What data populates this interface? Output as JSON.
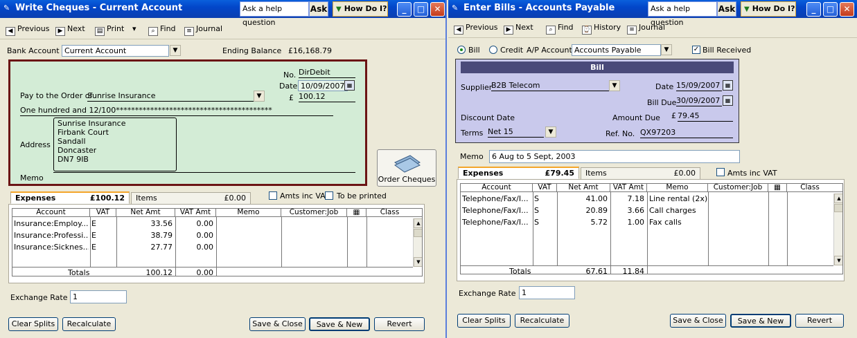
{
  "left": {
    "title": "Write Cheques - Current Account",
    "help_placeholder": "Ask a help question",
    "ask_label": "Ask",
    "howdoi_label": "How Do I?",
    "toolbar": {
      "previous": "Previous",
      "next": "Next",
      "print": "Print",
      "find": "Find",
      "journal": "Journal"
    },
    "bank_account_label": "Bank Account",
    "bank_account_value": "Current Account",
    "ending_balance_label": "Ending Balance",
    "ending_balance_value": "£16,168.79",
    "cheque": {
      "no_label": "No.",
      "no_value": "DirDebit",
      "date_label": "Date",
      "date_value": "10/09/2007",
      "pay_to_label": "Pay to the Order of",
      "pay_to_value": "Sunrise Insurance",
      "currency_symbol": "£",
      "amount_value": "100.12",
      "amount_words": "One hundred and 12/100*****************************************",
      "address_label": "Address",
      "address_lines": [
        "Sunrise Insurance",
        "Firbank Court",
        "Sandall",
        "Doncaster",
        "DN7 9IB"
      ],
      "memo_label": "Memo",
      "memo_value": ""
    },
    "order_cheques_label": "Order Cheques",
    "tabs": {
      "expenses_label": "Expenses",
      "expenses_amount": "£100.12",
      "items_label": "Items",
      "items_amount": "£0.00"
    },
    "amts_inc_vat_label": "Amts inc VAT",
    "to_be_printed_label": "To be printed",
    "columns": [
      "Account",
      "VAT",
      "Net Amt",
      "VAT Amt",
      "Memo",
      "Customer:Job",
      "",
      "Class"
    ],
    "rows": [
      {
        "account": "Insurance:Employ...",
        "vat": "E",
        "net": "33.56",
        "vatamt": "0.00"
      },
      {
        "account": "Insurance:Professi...",
        "vat": "E",
        "net": "38.79",
        "vatamt": "0.00"
      },
      {
        "account": "Insurance:Sicknes...",
        "vat": "E",
        "net": "27.77",
        "vatamt": "0.00"
      }
    ],
    "totals_label": "Totals",
    "totals_net": "100.12",
    "totals_vat": "0.00",
    "exchange_rate_label": "Exchange Rate",
    "exchange_rate_value": "1",
    "buttons": {
      "clear_splits": "Clear Splits",
      "recalculate": "Recalculate",
      "save_close": "Save & Close",
      "save_new": "Save & New",
      "revert": "Revert"
    }
  },
  "right": {
    "title": "Enter Bills - Accounts Payable",
    "help_placeholder": "Ask a help question",
    "ask_label": "Ask",
    "howdoi_label": "How Do I?",
    "toolbar": {
      "previous": "Previous",
      "next": "Next",
      "find": "Find",
      "history": "History",
      "journal": "Journal"
    },
    "bill_radio_label": "Bill",
    "credit_radio_label": "Credit",
    "ap_account_label": "A/P Account",
    "ap_account_value": "Accounts Payable",
    "bill_received_label": "Bill Received",
    "bill": {
      "heading": "Bill",
      "supplier_label": "Supplier",
      "supplier_value": "B2B Telecom",
      "date_label": "Date",
      "date_value": "15/09/2007",
      "bill_due_label": "Bill Due",
      "bill_due_value": "30/09/2007",
      "discount_date_label": "Discount Date",
      "amount_due_label": "Amount Due",
      "currency_symbol": "£",
      "amount_due_value": "79.45",
      "terms_label": "Terms",
      "terms_value": "Net 15",
      "ref_no_label": "Ref. No.",
      "ref_no_value": "QX97203"
    },
    "memo_label": "Memo",
    "memo_value": "6 Aug to 5 Sept, 2003",
    "tabs": {
      "expenses_label": "Expenses",
      "expenses_amount": "£79.45",
      "items_label": "Items",
      "items_amount": "£0.00"
    },
    "amts_inc_vat_label": "Amts inc VAT",
    "columns": [
      "Account",
      "VAT",
      "Net Amt",
      "VAT Amt",
      "Memo",
      "Customer:Job",
      "",
      "Class"
    ],
    "rows": [
      {
        "account": "Telephone/Fax/I...",
        "vat": "S",
        "net": "41.00",
        "vatamt": "7.18",
        "memo": "Line rental (2x)"
      },
      {
        "account": "Telephone/Fax/I...",
        "vat": "S",
        "net": "20.89",
        "vatamt": "3.66",
        "memo": "Call charges"
      },
      {
        "account": "Telephone/Fax/I...",
        "vat": "S",
        "net": "5.72",
        "vatamt": "1.00",
        "memo": "Fax calls"
      }
    ],
    "totals_label": "Totals",
    "totals_net": "67.61",
    "totals_vat": "11.84",
    "exchange_rate_label": "Exchange Rate",
    "exchange_rate_value": "1",
    "buttons": {
      "clear_splits": "Clear Splits",
      "recalculate": "Recalculate",
      "save_close": "Save & Close",
      "save_new": "Save & New",
      "revert": "Revert"
    }
  }
}
